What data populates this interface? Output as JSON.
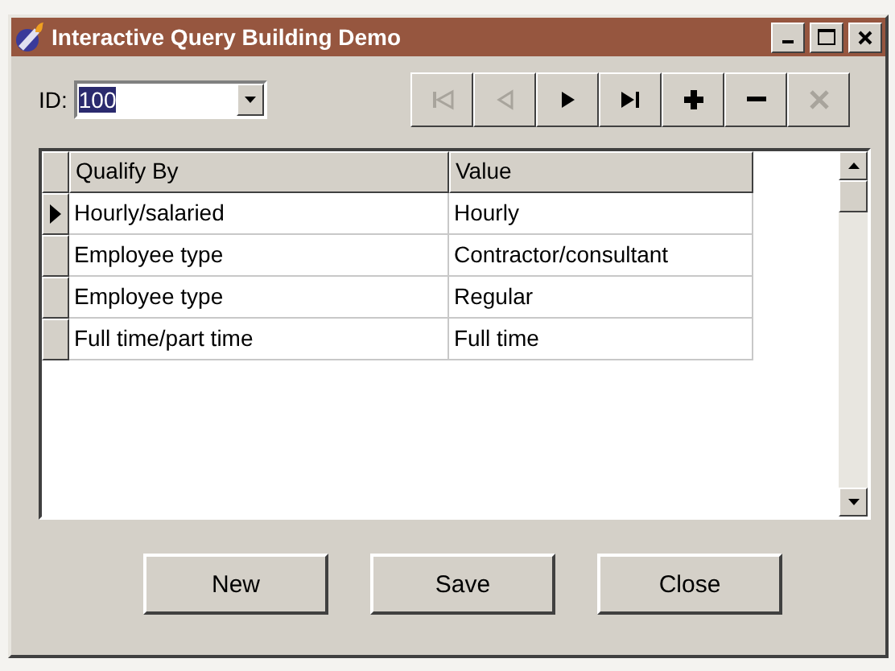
{
  "window": {
    "title": "Interactive Query Building Demo"
  },
  "id_field": {
    "label": "ID:",
    "value": "100"
  },
  "navigator": [
    {
      "kind": "first",
      "disabled": true
    },
    {
      "kind": "prev",
      "disabled": true
    },
    {
      "kind": "next",
      "disabled": false
    },
    {
      "kind": "last",
      "disabled": false
    },
    {
      "kind": "add",
      "disabled": false
    },
    {
      "kind": "delete",
      "disabled": false
    },
    {
      "kind": "cancel",
      "disabled": true
    }
  ],
  "table": {
    "columns": [
      "Qualify By",
      "Value"
    ],
    "rows": [
      {
        "cells": [
          "Hourly/salaried",
          "Hourly"
        ],
        "selected": true
      },
      {
        "cells": [
          "Employee type",
          "Contractor/consultant"
        ],
        "selected": false
      },
      {
        "cells": [
          "Employee type",
          "Regular"
        ],
        "selected": false
      },
      {
        "cells": [
          "Full time/part time",
          "Full time"
        ],
        "selected": false
      }
    ]
  },
  "buttons": [
    "New",
    "Save",
    "Close"
  ]
}
